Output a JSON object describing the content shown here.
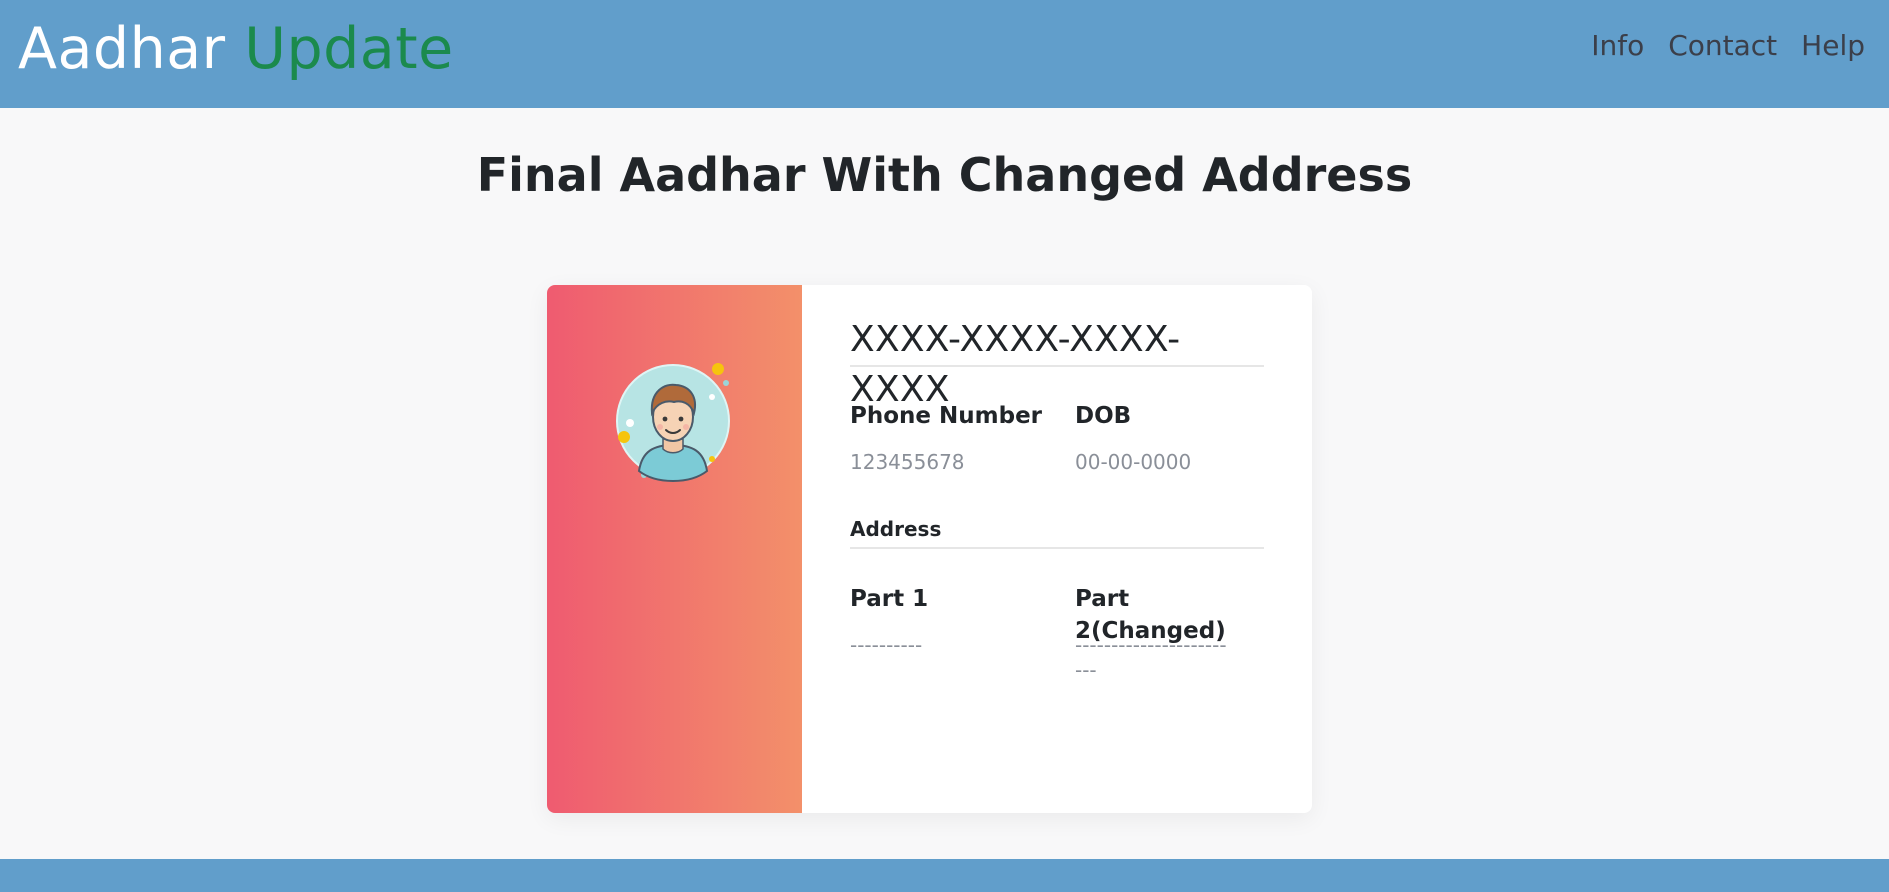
{
  "brand": {
    "part1": "Aadhar",
    "part2": "Update"
  },
  "nav": {
    "items": [
      "Info",
      "Contact",
      "Help"
    ]
  },
  "page": {
    "title": "Final Aadhar With Changed Address"
  },
  "card": {
    "aadhar_number": "XXXX-XXXX-XXXX-XXXX",
    "phone_label": "Phone Number",
    "phone_value": "123455678",
    "dob_label": "DOB",
    "dob_value": "00-00-0000",
    "address_heading": "Address",
    "part1_label": "Part 1",
    "part1_value": "----------",
    "part2_label": "Part 2(Changed)",
    "part2_value_line1": "---------------------",
    "part2_value_line2": "---"
  },
  "colors": {
    "navbar": "#619ecb",
    "brand_accent": "#1b8a4d",
    "gradient_start": "#ef5b70",
    "gradient_end": "#f3906a"
  },
  "icons": {
    "avatar": "user-avatar-illustration"
  }
}
